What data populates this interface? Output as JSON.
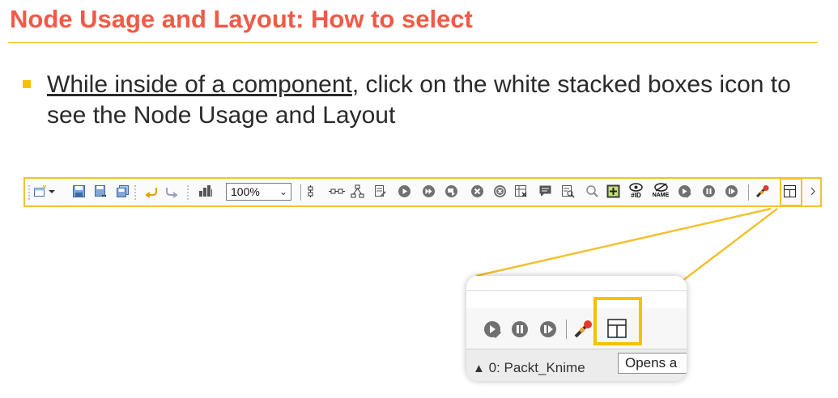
{
  "slide": {
    "title": "Node Usage and Layout: How to select",
    "bullet_underlined": "While inside of a component",
    "bullet_rest": ", click on the white stacked boxes icon to see the Node Usage and Layout"
  },
  "toolbar": {
    "zoom_value": "100%",
    "icons": [
      "new-workflow-icon",
      "dropdown-arrow-icon",
      "save-icon",
      "save-as-icon",
      "save-all-icon",
      "undo-icon",
      "redo-icon",
      "auto-layout-icon",
      "align-vertical-icon",
      "align-horizontal-icon",
      "distribute-icon",
      "configure-icon",
      "execute-icon",
      "execute-all-icon",
      "execute-open-view-icon",
      "cancel-icon",
      "cancel-all-icon",
      "reset-icon",
      "edit-annotation-icon",
      "open-view-icon",
      "zoom-search-icon",
      "add-metanode-icon",
      "show-node-id-icon",
      "hide-node-names-icon",
      "step-loop-icon",
      "pause-loop-icon",
      "resume-loop-icon",
      "open-dialog-icon",
      "node-usage-layout-icon",
      "chevron-right-icon"
    ],
    "id_label": "#ID",
    "name_label": "NAME"
  },
  "zoom_callout": {
    "status_text": "0: Packt_Knime",
    "tooltip_text": "Opens a"
  },
  "colors": {
    "title": "#f05a47",
    "accent": "#f2c230",
    "bullet": "#f6c100"
  }
}
